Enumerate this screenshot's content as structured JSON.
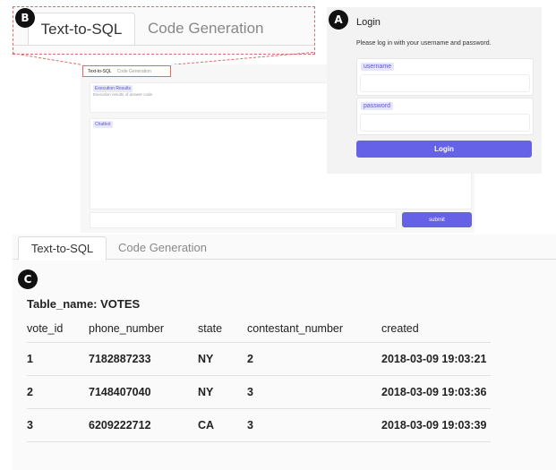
{
  "badges": {
    "a": "A",
    "b": "B",
    "c": "C"
  },
  "tabs": {
    "text_to_sql": "Text-to-SQL",
    "code_generation": "Code Generation"
  },
  "app": {
    "execution_label": "Execution Results",
    "execution_sub": "Execution results of answer code",
    "chatbot_label": "Chatbot",
    "submit_label": "submit"
  },
  "login": {
    "title": "Login",
    "description": "Please log in with your username and password.",
    "username_label": "username",
    "password_label": "password",
    "button_label": "Login"
  },
  "table": {
    "name": "Table_name: VOTES",
    "columns": [
      "vote_id",
      "phone_number",
      "state",
      "contestant_number",
      "created"
    ],
    "rows": [
      [
        "1",
        "7182887233",
        "NY",
        "2",
        "2018-03-09 19:03:21"
      ],
      [
        "2",
        "7148407040",
        "NY",
        "3",
        "2018-03-09 19:03:36"
      ],
      [
        "3",
        "6209222712",
        "CA",
        "3",
        "2018-03-09 19:03:39"
      ]
    ]
  },
  "colors": {
    "accent": "#6562e8",
    "highlight": "#e06a6a"
  }
}
